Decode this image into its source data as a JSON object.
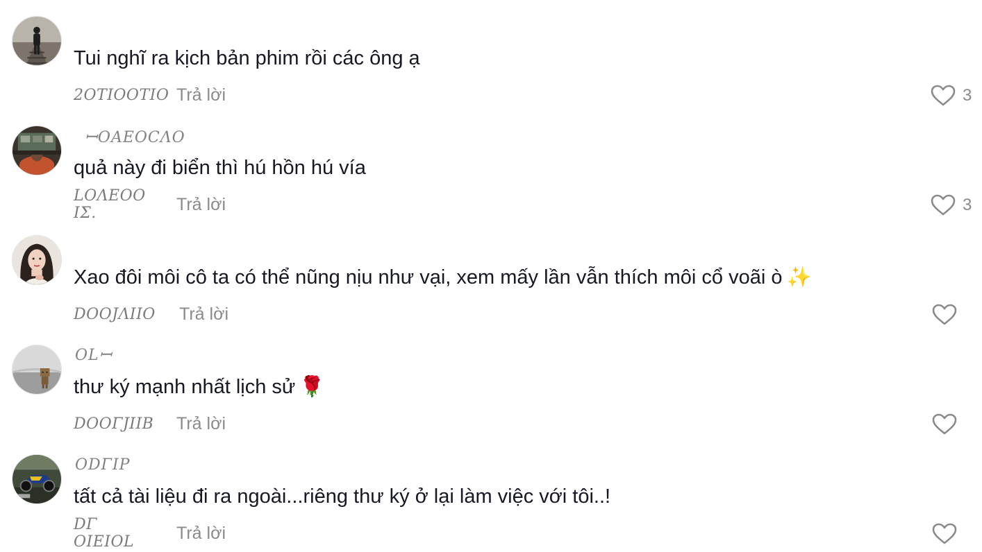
{
  "comments": [
    {
      "username": "",
      "text": "Tui nghĩ ra kịch bản phim rồi các ông ạ",
      "emoji": "",
      "date": "2OTIOOTIO",
      "reply_label": "Trả lời",
      "likes": "3",
      "avatar_icon": "person-walking-on-railway-avatar"
    },
    {
      "username": "ꟷOAEOCΛO",
      "text": "quả này đi biển thì hú hồn hú vía",
      "emoji": "",
      "date": "LOΛEOO IΣ.",
      "reply_label": "Trả lời",
      "likes": "3",
      "avatar_icon": "figure-at-desk-avatar"
    },
    {
      "username": "",
      "text": "Xao đôi môi cô ta có thể nũng nịu như vại, xem mấy lần vẫn thích môi cổ voãi ò",
      "emoji": "✨",
      "date": "DOOJΛIIO",
      "reply_label": "Trả lời",
      "likes": "",
      "avatar_icon": "woman-portrait-avatar"
    },
    {
      "username": "OLꟷ",
      "text": "thư ký mạnh nhất lịch sử",
      "emoji": "🌹",
      "date": "DOOΓJIIB",
      "reply_label": "Trả lời",
      "likes": "",
      "avatar_icon": "cardboard-robot-avatar"
    },
    {
      "username": "ODΓIP",
      "text": "tất cả tài liệu đi ra ngoài...riêng thư ký ở lại làm việc với tôi..!",
      "emoji": "",
      "date": "DΓ OIEIOL",
      "reply_label": "Trả lời",
      "likes": "",
      "avatar_icon": "motorbike-photo-avatar"
    }
  ],
  "colors": {
    "text": "#161823",
    "muted": "#8a8a8a",
    "heart_outline": "#8a8a8a"
  }
}
